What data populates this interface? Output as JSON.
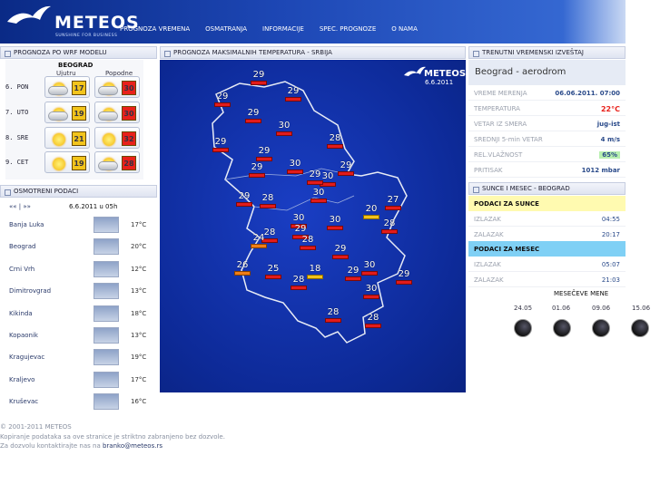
{
  "header": {
    "logo": "METEOS",
    "logo_sub": "SUNSHINE FOR BUSINESS",
    "nav": [
      "PROGNOZA VREMENA",
      "OSMATRANJA",
      "INFORMACIJE",
      "SPEC. PROGNOZE",
      "O NAMA"
    ]
  },
  "wrf": {
    "title": "PROGNOZA PO WRF MODELU",
    "city": "BEOGRAD",
    "col_morning": "Ujutru",
    "col_afternoon": "Popodne",
    "days": [
      {
        "day": "6. PON",
        "m_icon": "sun-cloud-icon",
        "m_temp": "17",
        "a_icon": "sun-cloud-icon",
        "a_temp": "30",
        "m_color": "#f2c41c",
        "a_color": "#e8211b"
      },
      {
        "day": "7. UTO",
        "m_icon": "sun-cloud-icon",
        "m_temp": "19",
        "a_icon": "sun-cloud-icon",
        "a_temp": "30",
        "m_color": "#f2c41c",
        "a_color": "#e8211b"
      },
      {
        "day": "8. SRE",
        "m_icon": "sun-icon",
        "m_temp": "21",
        "a_icon": "sun-icon",
        "a_temp": "32",
        "m_color": "#f2c41c",
        "a_color": "#e8211b"
      },
      {
        "day": "9. CET",
        "m_icon": "sun-icon",
        "m_temp": "19",
        "a_icon": "sun-cloud-icon",
        "a_temp": "28",
        "m_color": "#f2c41c",
        "a_color": "#e8211b"
      }
    ]
  },
  "obs": {
    "title": "OSMOTRENI PODACI",
    "nav": "«« | »»",
    "time": "6.6.2011 u 05h",
    "stations": [
      {
        "name": "Banja Luka",
        "temp": "17°C"
      },
      {
        "name": "Beograd",
        "temp": "20°C"
      },
      {
        "name": "Crni Vrh",
        "temp": "12°C"
      },
      {
        "name": "Dimitrovgrad",
        "temp": "13°C"
      },
      {
        "name": "Kikinda",
        "temp": "18°C"
      },
      {
        "name": "Kopaonik",
        "temp": "13°C"
      },
      {
        "name": "Kragujevac",
        "temp": "19°C"
      },
      {
        "name": "Kraljevo",
        "temp": "17°C"
      },
      {
        "name": "Kruševac",
        "temp": "16°C"
      }
    ]
  },
  "map": {
    "title": "PROGNOZA MAKSIMALNIH TEMPERATURA - SRBIJA",
    "logo": "METEOS",
    "date": "6.6.2011",
    "temps": [
      "29",
      "29",
      "29",
      "29",
      "30",
      "28",
      "29",
      "29",
      "30",
      "29",
      "30",
      "29",
      "29",
      "29",
      "28",
      "30",
      "27",
      "20",
      "28",
      "30",
      "29",
      "30",
      "28",
      "24",
      "28",
      "29",
      "26",
      "25",
      "18",
      "28",
      "29",
      "30",
      "29",
      "30",
      "28",
      "28"
    ]
  },
  "report": {
    "title": "TRENUTNI VREMENSKI IZVEŠTAJ",
    "station": "Beograd - aerodrom",
    "rows": [
      {
        "label": "VREME MERENJA",
        "value": "06.06.2011. 07:00"
      },
      {
        "label": "TEMPERATURA",
        "value": "22°C"
      },
      {
        "label": "VETAR IZ SMERA",
        "value": "jug-ist"
      },
      {
        "label": "SREDNJI 5-min VETAR",
        "value": "4 m/s"
      },
      {
        "label": "REL.VLAŽNOST",
        "value": "65%"
      },
      {
        "label": "PRITISAK",
        "value": "1012 mbar"
      }
    ],
    "temp_color": "#e8211b",
    "humidity_bg": "#b8f0b0"
  },
  "sun": {
    "title": "SUNCE I MESEC - BEOGRAD",
    "sun_head": "PODACI ZA SUNCE",
    "moon_head": "PODACI ZA MESEC",
    "sunrise_label": "IZLAZAK",
    "sunrise": "04:55",
    "sunset_label": "ZALAZAK",
    "sunset": "20:17",
    "moonrise_label": "IZLAZAK",
    "moonrise": "05:07",
    "moonset_label": "ZALAZAK",
    "moonset": "21:03",
    "phases_title": "MESEČEVE MENE",
    "phases": [
      "24.05",
      "01.06",
      "09.06",
      "15.06"
    ]
  },
  "footer": {
    "line1": "© 2001-2011 METEOS",
    "line2": "Kopiranje podataka sa ove stranice je striktno zabranjeno bez dozvole.",
    "line3_pre": "Za dozvolu kontaktirajte nas na ",
    "email": "branko@meteos.rs"
  }
}
